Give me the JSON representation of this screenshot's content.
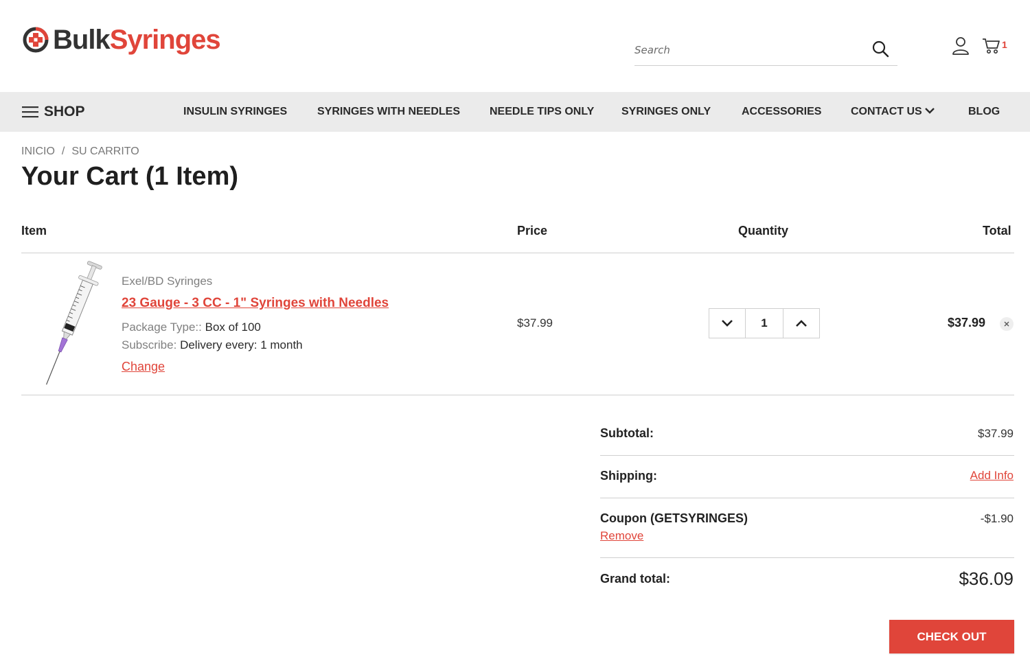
{
  "brand": {
    "logo_part1": "Bulk",
    "logo_part2": "Syringes",
    "accent_color": "#e0453a",
    "logo_icon": "medical-cross-icon"
  },
  "header": {
    "search_placeholder": "Search",
    "search_icon": "search-icon",
    "account_icon": "user-icon",
    "cart_icon": "cart-icon",
    "cart_count": "1"
  },
  "nav": {
    "shop_label": "SHOP",
    "items": [
      {
        "label": "INSULIN SYRINGES"
      },
      {
        "label": "SYRINGES WITH NEEDLES"
      },
      {
        "label": "NEEDLE TIPS ONLY"
      },
      {
        "label": "SYRINGES ONLY"
      },
      {
        "label": "ACCESSORIES"
      },
      {
        "label": "CONTACT US"
      },
      {
        "label": "BLOG"
      }
    ]
  },
  "breadcrumb": {
    "items": [
      "INICIO",
      "SU CARRITO"
    ],
    "separator": "/"
  },
  "page": {
    "title": "Your Cart (1 Item)"
  },
  "cart_table": {
    "headers": {
      "item": "Item",
      "price": "Price",
      "quantity": "Quantity",
      "total": "Total"
    },
    "items": [
      {
        "brand": "Exel/BD Syringes",
        "name": "23 Gauge - 3 CC - 1\" Syringes with Needles",
        "options": [
          {
            "key": "Package Type::",
            "value": "Box of 100"
          },
          {
            "key": "Subscribe:",
            "value": "Delivery every: 1 month"
          }
        ],
        "change_label": "Change",
        "price": "$37.99",
        "quantity": "1",
        "total": "$37.99"
      }
    ]
  },
  "totals": {
    "subtotal_label": "Subtotal:",
    "subtotal_value": "$37.99",
    "shipping_label": "Shipping:",
    "shipping_link": "Add Info",
    "coupon_label": "Coupon (GETSYRINGES)",
    "coupon_remove": "Remove",
    "coupon_value": "-$1.90",
    "grand_label": "Grand total:",
    "grand_value": "$36.09"
  },
  "checkout": {
    "label": "CHECK OUT"
  }
}
